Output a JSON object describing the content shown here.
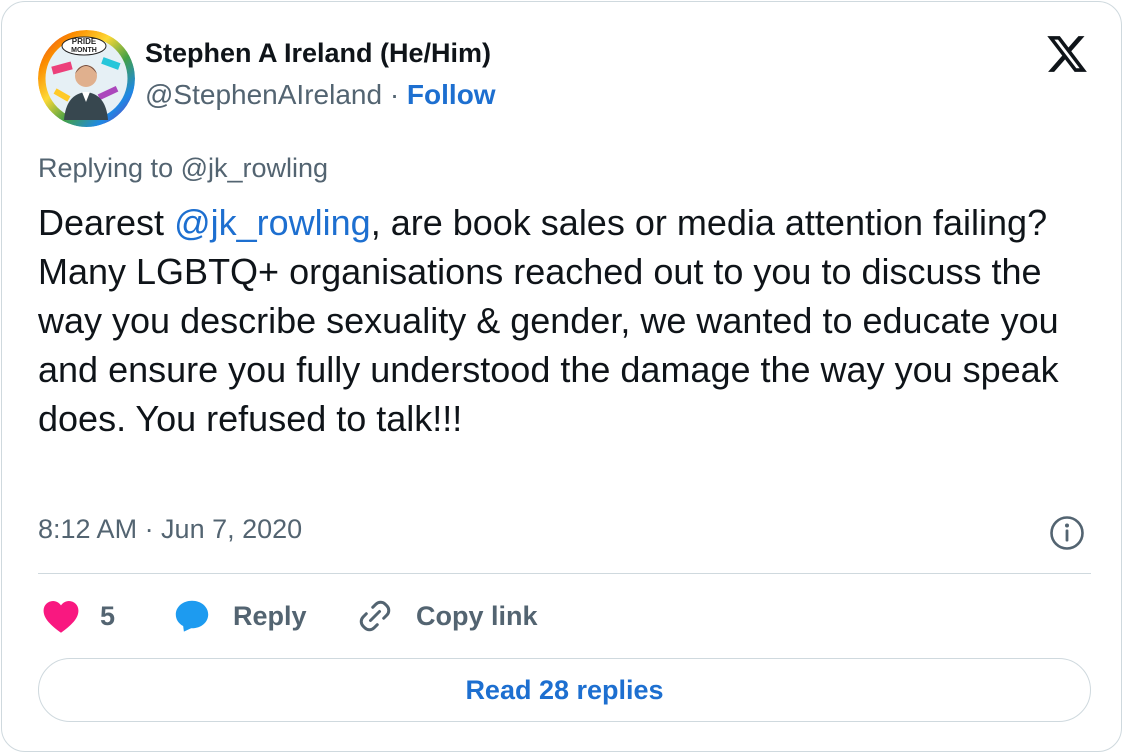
{
  "author": {
    "display_name": "Stephen A Ireland (He/Him)",
    "handle": "@StephenAIreland",
    "separator": "·",
    "follow_label": "Follow",
    "avatar_badge_line1": "PRIDE",
    "avatar_badge_line2": "MONTH"
  },
  "brand": {
    "logo_icon": "x-logo-icon",
    "accent_color": "#1d6fd0",
    "like_color": "#f91880",
    "reply_icon_color": "#1d9bf0"
  },
  "tweet": {
    "replying_to": "Replying to @jk_rowling",
    "text_before": "Dearest ",
    "mention": "@jk_rowling",
    "text_after": ", are book sales or media attention failing? Many LGBTQ+ organisations reached out to you to discuss the way you describe sexuality & gender, we wanted to educate you and ensure you fully understood the damage the way you speak does. You refused to talk!!!",
    "timestamp": "8:12 AM · Jun 7, 2020"
  },
  "actions": {
    "like_count": "5",
    "reply_label": "Reply",
    "copy_link_label": "Copy link"
  },
  "footer": {
    "read_replies_label": "Read 28 replies"
  }
}
